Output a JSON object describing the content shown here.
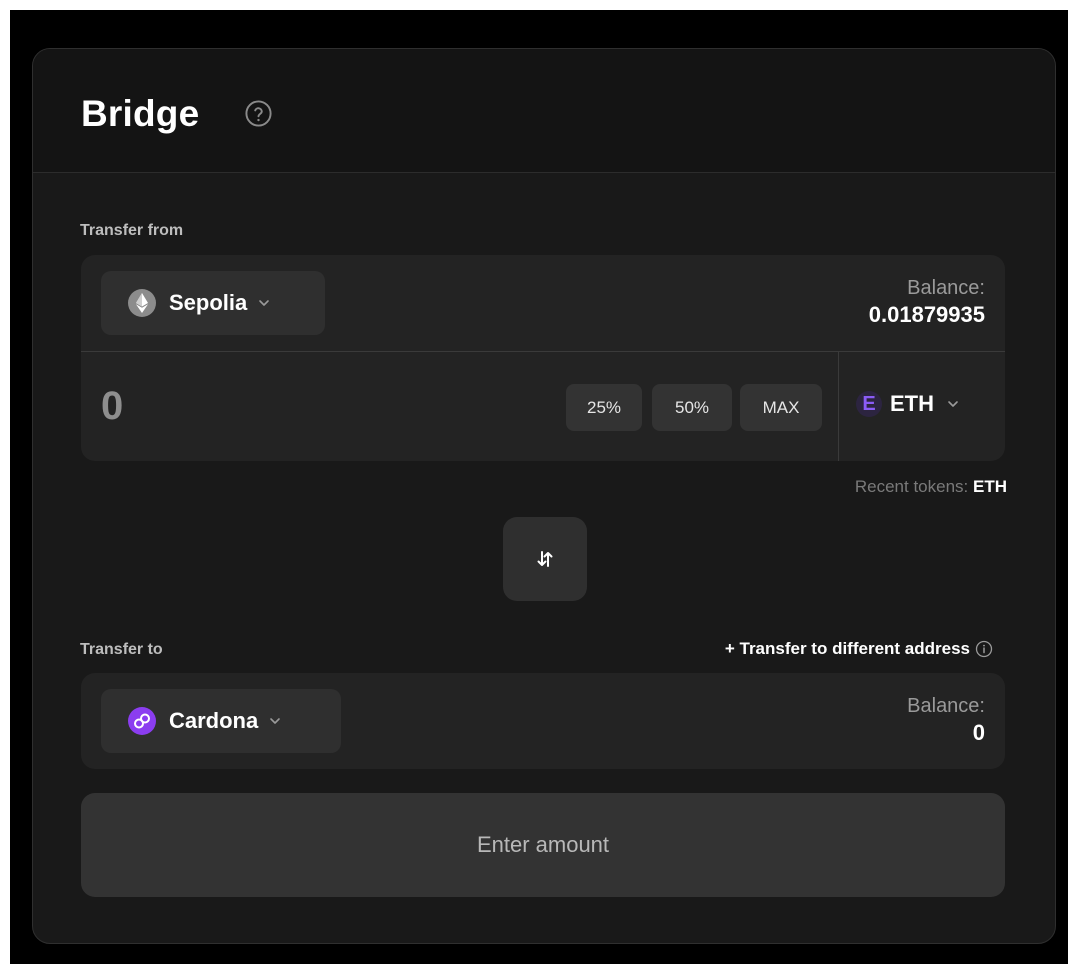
{
  "header": {
    "title": "Bridge",
    "help_icon": "question-circle-icon"
  },
  "from": {
    "label": "Transfer from",
    "chain": {
      "name": "Sepolia",
      "icon": "ethereum-icon"
    },
    "balance_label": "Balance:",
    "balance_value": "0.01879935",
    "amount_value": "0",
    "percent_buttons": [
      "25%",
      "50%",
      "MAX"
    ],
    "token": {
      "badge": "E",
      "symbol": "ETH"
    },
    "recent_tokens_label": "Recent tokens:",
    "recent_tokens_value": "ETH"
  },
  "swap_icon": "swap-arrows-icon",
  "to": {
    "label": "Transfer to",
    "different_address_link": "+ Transfer to different address",
    "chain": {
      "name": "Cardona",
      "icon": "polygon-icon"
    },
    "balance_label": "Balance:",
    "balance_value": "0"
  },
  "submit_label": "Enter amount",
  "colors": {
    "background": "#000000",
    "card": "#191919",
    "panel": "#232323",
    "button": "#2f2f2f",
    "accent_purple": "#8b5cf6"
  }
}
